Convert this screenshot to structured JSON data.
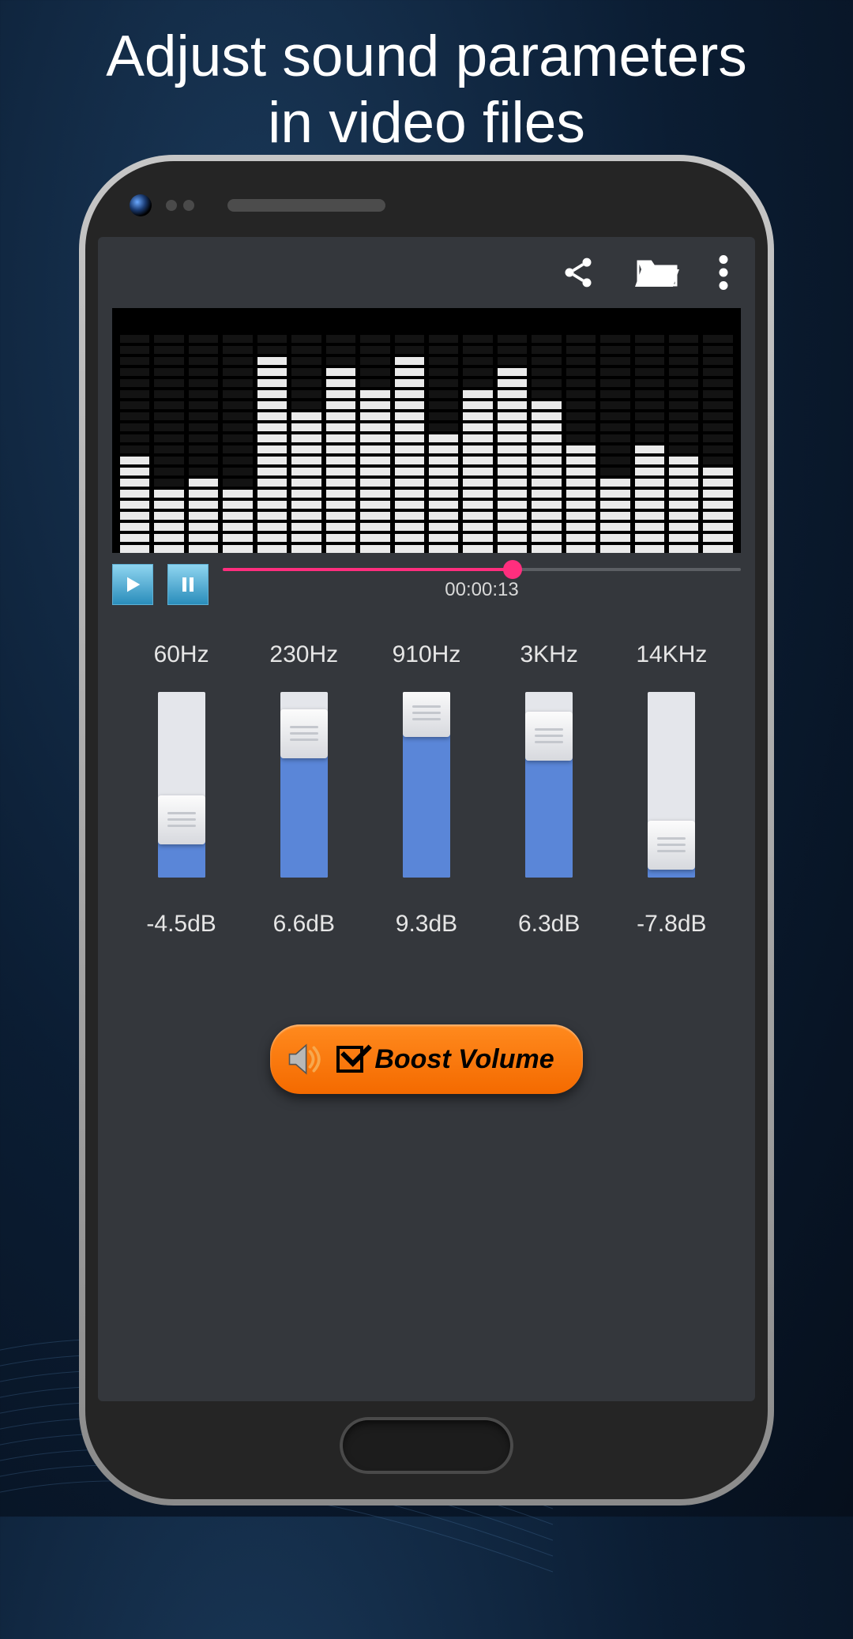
{
  "headline_line1": "Adjust sound parameters",
  "headline_line2": "in video files",
  "timecode": "00:00:13",
  "seek_pct": 56,
  "eq_bands": [
    {
      "freq": "60Hz",
      "db": "-4.5dB",
      "db_num": -4.5
    },
    {
      "freq": "230Hz",
      "db": "6.6dB",
      "db_num": 6.6
    },
    {
      "freq": "910Hz",
      "db": "9.3dB",
      "db_num": 9.3
    },
    {
      "freq": "3KHz",
      "db": "6.3dB",
      "db_num": 6.3
    },
    {
      "freq": "14KHz",
      "db": "-7.8dB",
      "db_num": -7.8
    }
  ],
  "boost_label": "Boost Volume",
  "boost_checked": true,
  "visualizer_heights": [
    9,
    6,
    7,
    6,
    18,
    13,
    17,
    15,
    18,
    11,
    15,
    17,
    14,
    10,
    7,
    10,
    9,
    8
  ],
  "colors": {
    "accent_pink": "#ff2e7e",
    "eq_blue": "#5a86d8",
    "boost_orange": "#f46a00"
  }
}
